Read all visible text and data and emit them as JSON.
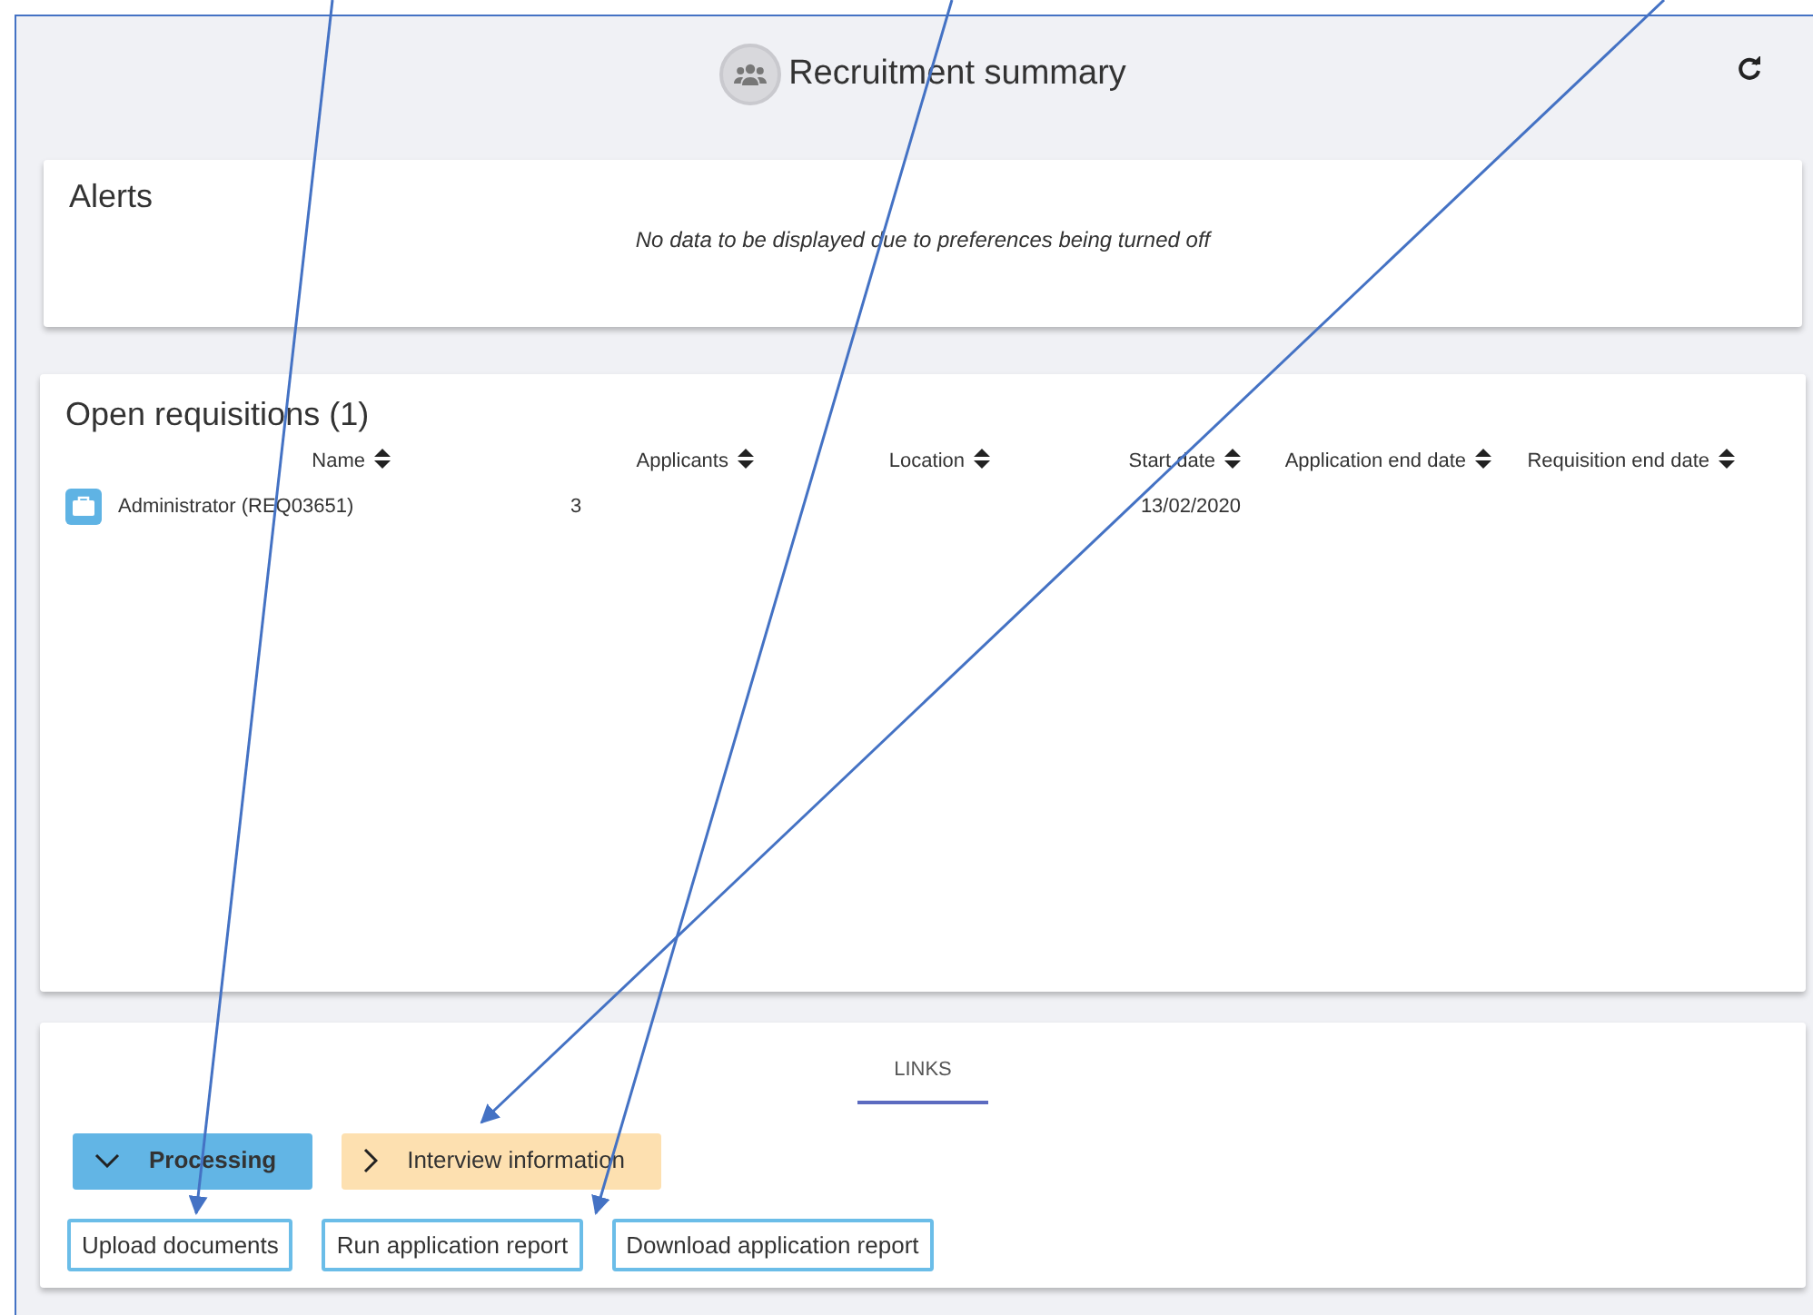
{
  "header": {
    "title": "Recruitment summary"
  },
  "alerts": {
    "title": "Alerts",
    "message": "No data to be displayed due to preferences being turned off"
  },
  "requisitions": {
    "title": "Open requisitions (1)",
    "columns": [
      {
        "label": "Name"
      },
      {
        "label": "Applicants"
      },
      {
        "label": "Location"
      },
      {
        "label": "Start date"
      },
      {
        "label": "Application end date"
      },
      {
        "label": "Requisition end date"
      }
    ],
    "rows": [
      {
        "cells": [
          "Administrator (REQ03651)",
          "3",
          "",
          "13/02/2020",
          "",
          ""
        ]
      }
    ]
  },
  "links": {
    "tabs": [
      {
        "label": "LINKS",
        "selected": true
      }
    ],
    "sections": [
      {
        "label": "Processing",
        "expanded": true,
        "color": "#62b5e5"
      },
      {
        "label": "Interview information",
        "expanded": false,
        "color": "#fde0b0"
      }
    ],
    "buttons": [
      "Upload documents",
      "Run application report",
      "Download application report"
    ]
  }
}
